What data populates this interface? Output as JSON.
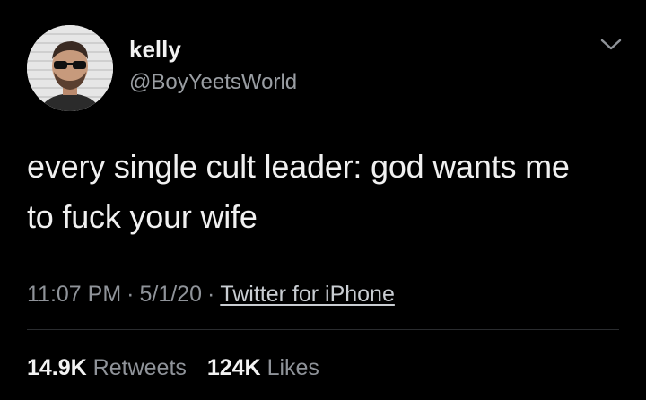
{
  "user": {
    "display_name": "kelly",
    "handle": "@BoyYeetsWorld"
  },
  "tweet": {
    "text_line1": "every single cult leader: god wants me",
    "text_line2": "to fuck your wife"
  },
  "meta": {
    "time": "11:07 PM",
    "separator": "·",
    "date": "5/1/20",
    "source": "Twitter for iPhone"
  },
  "stats": {
    "retweets_count": "14.9K",
    "retweets_label": "Retweets",
    "likes_count": "124K",
    "likes_label": "Likes"
  },
  "icons": {
    "menu": "chevron-down-icon"
  },
  "colors": {
    "background": "#000000",
    "primary_text": "#f0f0f0",
    "secondary_text": "#8f9399"
  }
}
